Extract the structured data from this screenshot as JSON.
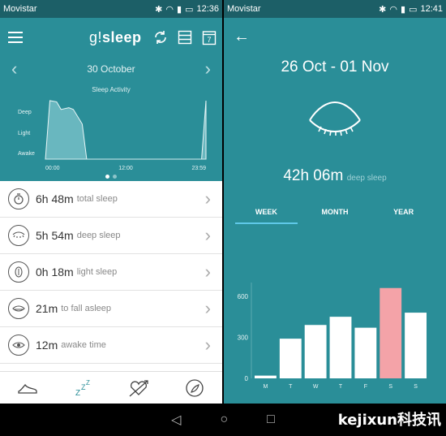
{
  "left": {
    "status": {
      "carrier": "Movistar",
      "time": "12:36"
    },
    "app_title": {
      "prefix": "g!",
      "suffix": "sleep"
    },
    "toolbar": {
      "calendar_day": "7"
    },
    "date": "30 October",
    "chart_caption": "Sleep Activity",
    "chart_data": {
      "type": "area",
      "title": "Sleep Activity",
      "y_categories": [
        "Awake",
        "Light",
        "Deep"
      ],
      "x_ticks": [
        "00:00",
        "12:00",
        "23:59"
      ],
      "points": [
        {
          "t": "00:00",
          "level": 0.0
        },
        {
          "t": "00:40",
          "level": 1.0
        },
        {
          "t": "01:40",
          "level": 0.98
        },
        {
          "t": "02:20",
          "level": 0.85
        },
        {
          "t": "03:30",
          "level": 0.88
        },
        {
          "t": "04:10",
          "level": 0.85
        },
        {
          "t": "05:30",
          "level": 0.6
        },
        {
          "t": "06:10",
          "level": 0.0
        },
        {
          "t": "23:20",
          "level": 0.0
        },
        {
          "t": "23:59",
          "level": 1.0
        }
      ]
    },
    "metrics": [
      {
        "icon": "stopwatch-icon",
        "value": "6h 48m",
        "label": "total sleep"
      },
      {
        "icon": "closed-eye-icon",
        "value": "5h 54m",
        "label": "deep sleep"
      },
      {
        "icon": "light-sleep-icon",
        "value": "0h 18m",
        "label": "light sleep"
      },
      {
        "icon": "eye-half-icon",
        "value": "21m",
        "label": "to fall asleep"
      },
      {
        "icon": "eye-icon",
        "value": "12m",
        "label": "awake time"
      }
    ],
    "bottom_nav": [
      "shoe-icon",
      "zzz-icon",
      "heart-arrow-icon",
      "globe-leaf-icon"
    ]
  },
  "right": {
    "status": {
      "carrier": "Movistar",
      "time": "12:41"
    },
    "range": "26 Oct - 01 Nov",
    "deep_total": {
      "value": "42h 06m",
      "label": "deep sleep"
    },
    "tabs": [
      "WEEK",
      "MONTH",
      "YEAR"
    ],
    "active_tab": "WEEK",
    "chart_data": {
      "type": "bar",
      "categories": [
        "M",
        "T",
        "W",
        "T",
        "F",
        "S",
        "S"
      ],
      "values": [
        20,
        290,
        390,
        450,
        370,
        660,
        480
      ],
      "y_ticks": [
        "0",
        "300",
        "600"
      ],
      "ylim": [
        0,
        700
      ],
      "highlight_index": 5,
      "colors": {
        "bar": "#ffffff",
        "highlight": "#f4a3a8"
      }
    }
  },
  "watermark": "kejixun科技讯",
  "system_nav": [
    "back-icon",
    "home-icon",
    "recents-icon"
  ]
}
